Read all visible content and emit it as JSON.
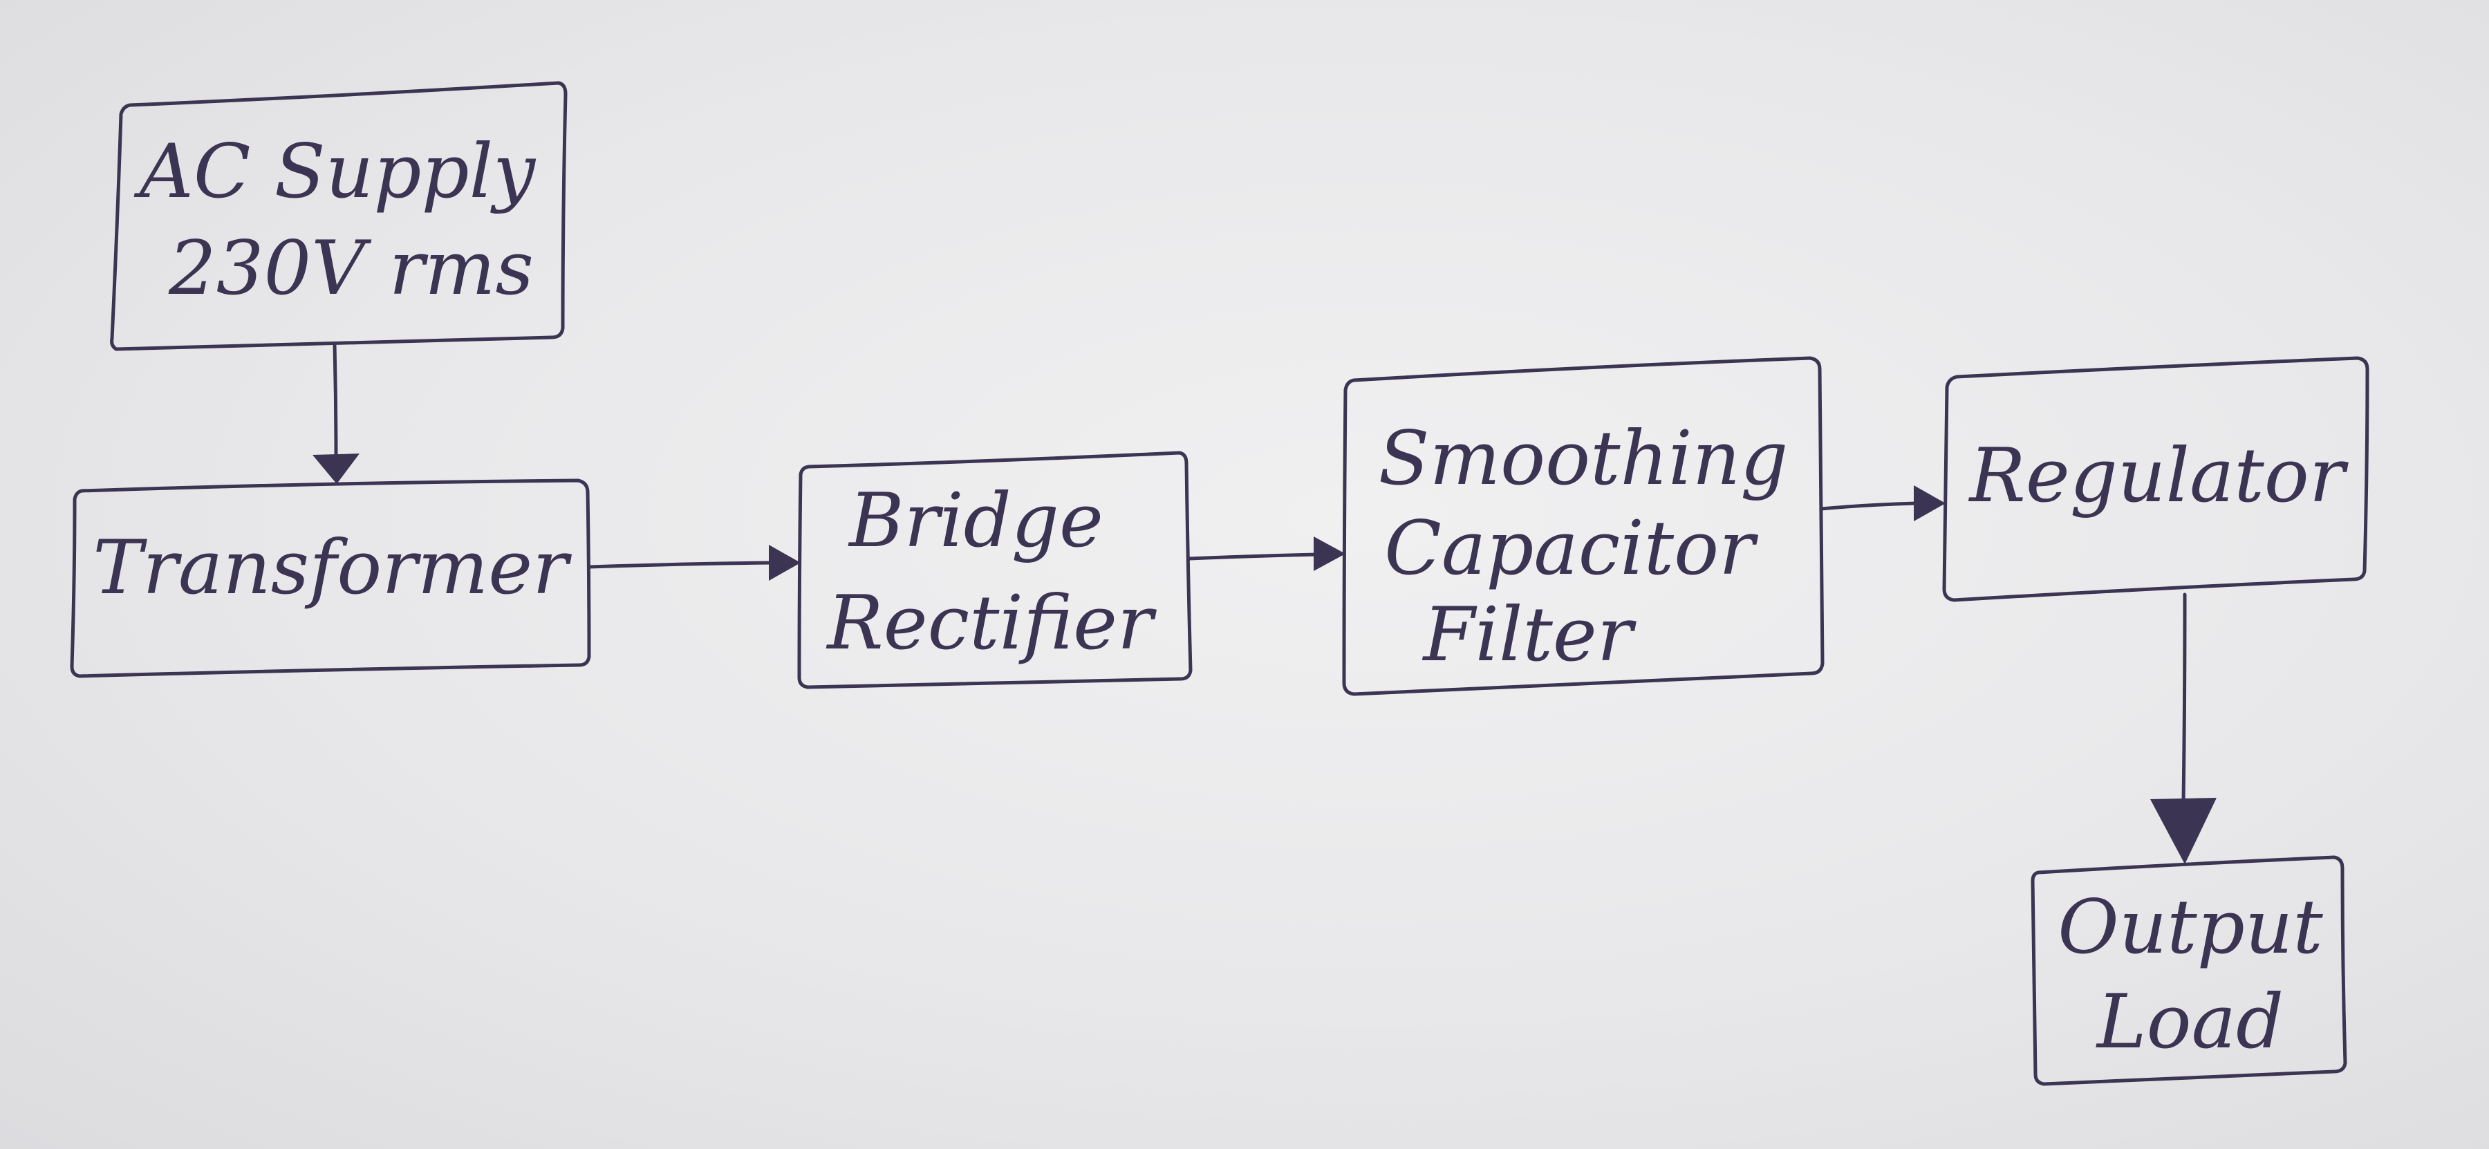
{
  "diagram": {
    "type": "block-diagram",
    "ink_color": "#3b3452",
    "paper_color": "#ececed",
    "nodes": {
      "ac_supply": {
        "line1": "AC Supply",
        "line2": "230V rms"
      },
      "transformer": {
        "line1": "Transformer"
      },
      "bridge_rectifier": {
        "line1": "Bridge",
        "line2": "Rectifier"
      },
      "smoothing_filter": {
        "line1": "Smoothing",
        "line2": "Capacitor",
        "line3": "Filter"
      },
      "regulator": {
        "line1": "Regulator"
      },
      "output_load": {
        "line1": "Output",
        "line2": "Load"
      }
    },
    "edges": [
      {
        "from": "ac_supply",
        "to": "transformer"
      },
      {
        "from": "transformer",
        "to": "bridge_rectifier"
      },
      {
        "from": "bridge_rectifier",
        "to": "smoothing_filter"
      },
      {
        "from": "smoothing_filter",
        "to": "regulator"
      },
      {
        "from": "regulator",
        "to": "output_load"
      }
    ]
  }
}
